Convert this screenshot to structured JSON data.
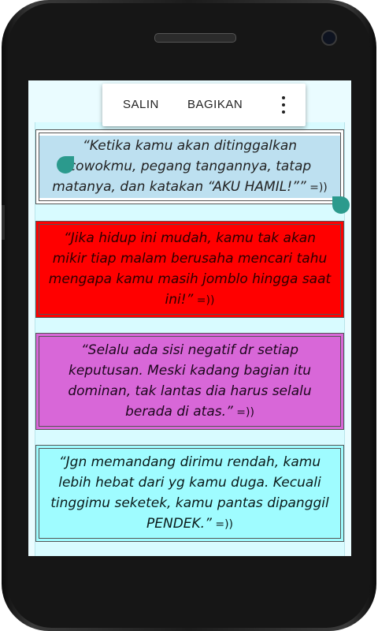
{
  "popup": {
    "copy_label": "SALIN",
    "share_label": "BAGIKAN",
    "more_icon": "more-vert-icon"
  },
  "quotes": [
    {
      "text": "“Ketika kamu akan ditinggalkan cowokmu, pegang tangannya, tatap matanya, dan katakan “AKU HAMIL!””",
      "suffix": " =))",
      "color": "#ffffff",
      "selected": true
    },
    {
      "text": "“Jika hidup ini mudah, kamu tak akan mikir tiap malam berusaha mencari tahu mengapa kamu masih jomblo hingga saat ini!”",
      "suffix": " =))",
      "color": "#ff0000"
    },
    {
      "text": "“Selalu ada sisi negatif dr setiap keputusan. Meski kadang bagian itu dominan, tak lantas dia harus selalu berada di atas.”",
      "suffix": " =))",
      "color": "#d867d8"
    },
    {
      "text": "“Jgn memandang dirimu rendah, kamu lebih hebat dari yg kamu duga. Kecuali tinggimu seketek, kamu pantas dipanggil PENDEK.”",
      "suffix": " =))",
      "color": "#9ffcff"
    }
  ],
  "colors": {
    "selection_handle": "#2b9a8d",
    "selection_highlight": "#bde0f0",
    "background": "#d8fbff"
  }
}
